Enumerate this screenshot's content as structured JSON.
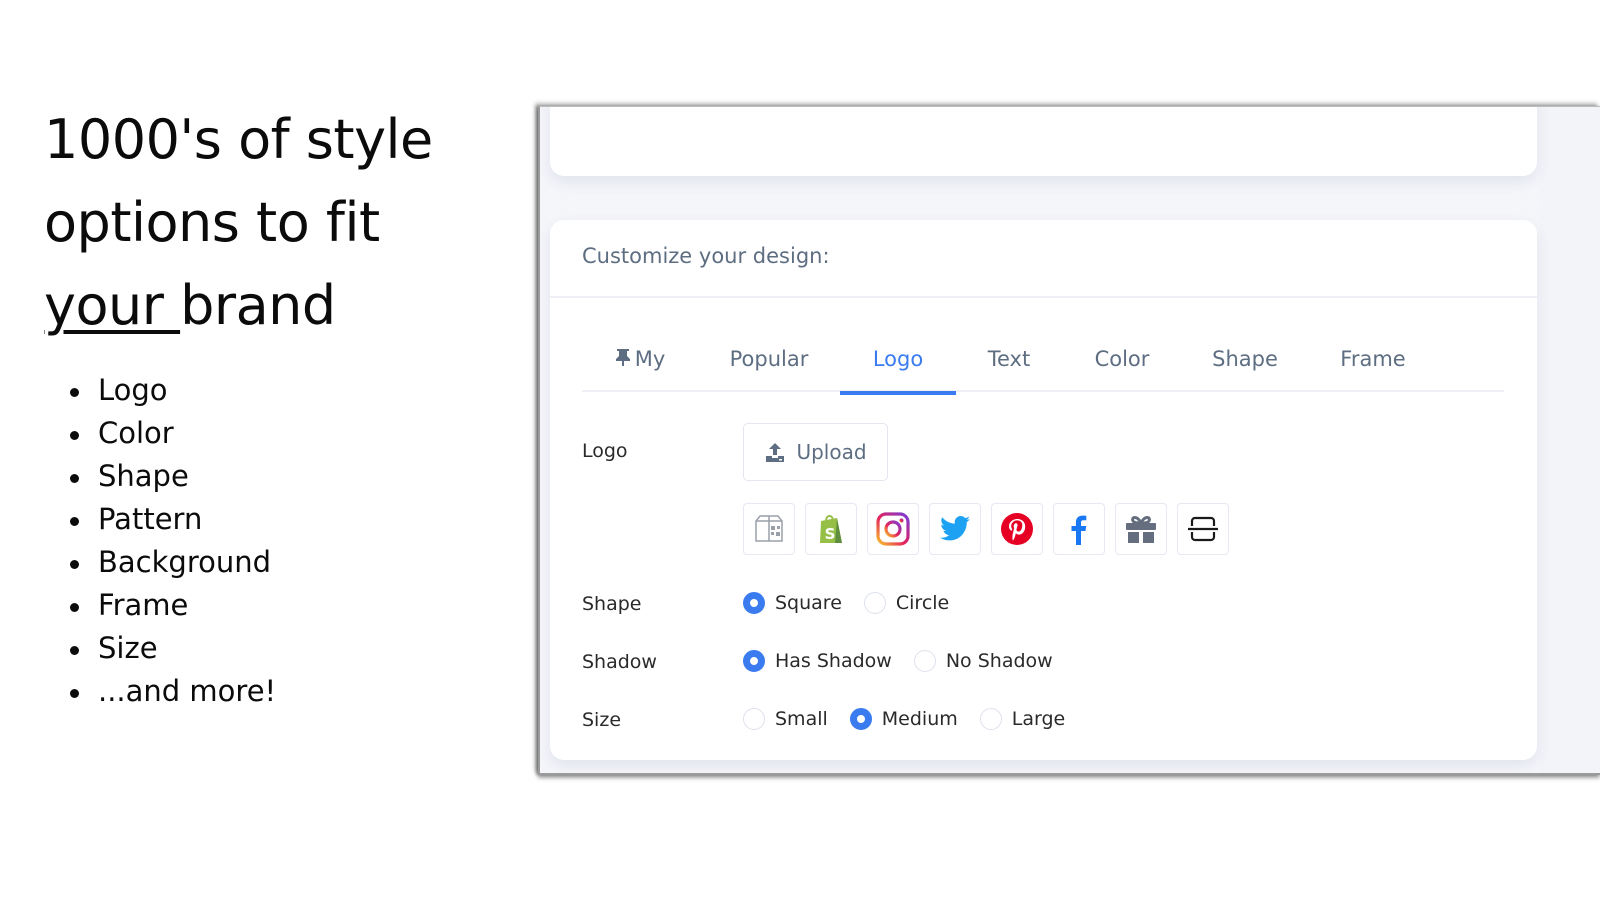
{
  "headline": {
    "line1": "1000's of style",
    "line2": "options to fit",
    "line3_underlined": "your ",
    "line3_rest": "brand"
  },
  "features": [
    "Logo",
    "Color",
    "Shape",
    "Pattern",
    "Background",
    "Frame",
    "Size",
    "...and more!"
  ],
  "app": {
    "header": "Customize your design:",
    "tabs": [
      {
        "label": "My",
        "icon": "pin-icon",
        "active": false
      },
      {
        "label": "Popular",
        "active": false
      },
      {
        "label": "Logo",
        "active": true
      },
      {
        "label": "Text",
        "active": false
      },
      {
        "label": "Color",
        "active": false
      },
      {
        "label": "Shape",
        "active": false
      },
      {
        "label": "Frame",
        "active": false
      }
    ],
    "logo": {
      "label": "Logo",
      "upload_label": "Upload",
      "presets": [
        "box-qr-icon",
        "shopify-icon",
        "instagram-icon",
        "twitter-icon",
        "pinterest-icon",
        "facebook-icon",
        "gift-icon",
        "scan-frame-icon"
      ]
    },
    "shape": {
      "label": "Shape",
      "options": [
        {
          "label": "Square",
          "checked": true
        },
        {
          "label": "Circle",
          "checked": false
        }
      ]
    },
    "shadow": {
      "label": "Shadow",
      "options": [
        {
          "label": "Has Shadow",
          "checked": true
        },
        {
          "label": "No Shadow",
          "checked": false
        }
      ]
    },
    "size": {
      "label": "Size",
      "options": [
        {
          "label": "Small",
          "checked": false
        },
        {
          "label": "Medium",
          "checked": true
        },
        {
          "label": "Large",
          "checked": false
        }
      ]
    },
    "colors": {
      "accent": "#3a7cf0",
      "muted_text": "#5e6e82",
      "shopify": "#95bf47",
      "twitter": "#1da1f2",
      "pinterest": "#e60023",
      "facebook": "#1877f2"
    }
  }
}
